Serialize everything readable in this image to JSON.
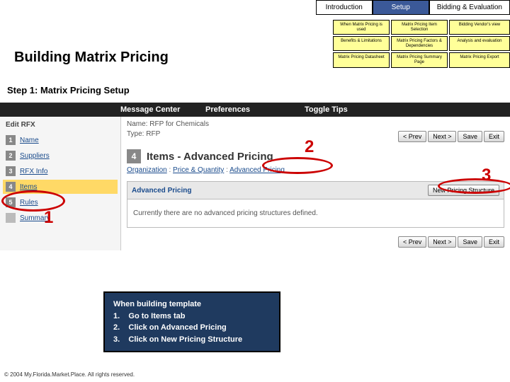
{
  "tabs": {
    "intro": "Introduction",
    "setup": "Setup",
    "eval": "Bidding & Evaluation"
  },
  "subgrid": [
    "When Matrix Pricing is used",
    "Matrix Pricing Item Selection",
    "Bidding Vendor's view",
    "Benefits & Limitations",
    "Matrix Pricing Factors & Dependencies",
    "Analysis and evaluation",
    "Matrix Pricing Datasheet",
    "Matrix Pricing Summary Page",
    "Matrix Pricing Export"
  ],
  "title": "Building Matrix Pricing",
  "step": "Step 1: Matrix Pricing Setup",
  "blackbar": {
    "a": "Message Center",
    "b": "Preferences",
    "c": "Toggle Tips"
  },
  "meta": {
    "name_l": "Name:",
    "name_v": "RFP for Chemicals",
    "type_l": "Type:",
    "type_v": "RFP"
  },
  "btns": {
    "prev": "< Prev",
    "next": "Next >",
    "save": "Save",
    "exit": "Exit"
  },
  "edit": "Edit RFX",
  "nav": [
    {
      "n": "1",
      "t": "Name"
    },
    {
      "n": "2",
      "t": "Suppliers"
    },
    {
      "n": "3",
      "t": "RFX Info"
    },
    {
      "n": "4",
      "t": "Items"
    },
    {
      "n": "5",
      "t": "Rules"
    },
    {
      "n": "",
      "t": "Summary"
    }
  ],
  "sec": {
    "num": "4",
    "title": "Items - Advanced Pricing"
  },
  "crumb": {
    "a": "Organization",
    "sep": " : ",
    "b": "Price & Quantity",
    "c": "Advanced Pricing"
  },
  "panel": {
    "head": "Advanced Pricing",
    "btn": "New Pricing Structure",
    "body": "Currently there are no advanced pricing structures defined."
  },
  "callouts": {
    "n1": "1",
    "n2": "2",
    "n3": "3"
  },
  "instr": {
    "head": "When building template",
    "i1": "Go to Items tab",
    "i2": "Click on Advanced Pricing",
    "i3": "Click on New Pricing Structure"
  },
  "copy": "© 2004 My.Florida.Market.Place. All rights reserved."
}
